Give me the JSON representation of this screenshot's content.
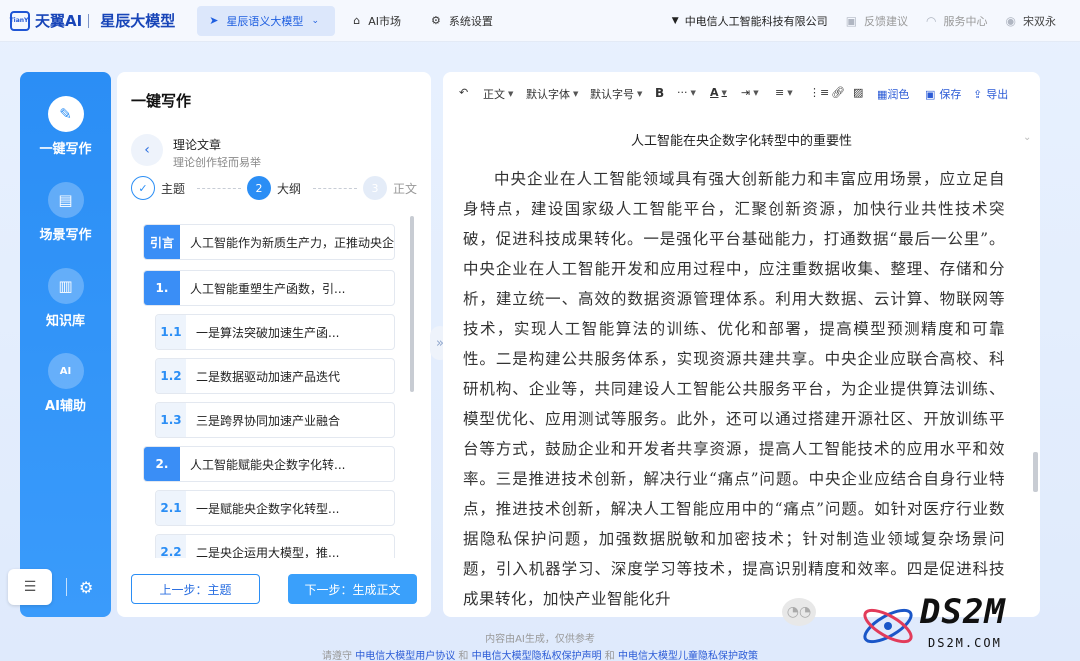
{
  "header": {
    "logo_badge": "TianYi",
    "brand": "天翼AI",
    "product": "星辰大模型",
    "nav": [
      {
        "label": "星辰语义大模型",
        "icon": "send-icon",
        "active": true
      },
      {
        "label": "AI市场",
        "icon": "store-icon",
        "active": false
      },
      {
        "label": "系统设置",
        "icon": "gear-icon",
        "active": false
      }
    ],
    "company": "中电信人工智能科技有限公司",
    "feedback": "反馈建议",
    "service": "服务中心",
    "user": "宋双永"
  },
  "sidebar": {
    "items": [
      {
        "label": "一键写作",
        "icon": "pen-icon",
        "active": true
      },
      {
        "label": "场景写作",
        "icon": "document-icon",
        "active": false
      },
      {
        "label": "知识库",
        "icon": "books-icon",
        "active": false
      },
      {
        "label": "AI辅助",
        "icon": "ai-icon",
        "active": false
      }
    ]
  },
  "outline_panel": {
    "title": "一键写作",
    "article_type": "理论文章",
    "article_subtitle": "理论创作轻而易举",
    "steps": [
      {
        "label": "主题",
        "state": "done",
        "num": "✓"
      },
      {
        "label": "大纲",
        "state": "current",
        "num": "2"
      },
      {
        "label": "正文",
        "state": "todo",
        "num": "3"
      }
    ],
    "items": [
      {
        "num": "引言",
        "text": "人工智能作为新质生产力，正推动央企",
        "level": "intro"
      },
      {
        "num": "1.",
        "text": "人工智能重塑生产函数，引...",
        "level": "level1"
      },
      {
        "num": "1.1",
        "text": "一是算法突破加速生产函...",
        "level": "level2"
      },
      {
        "num": "1.2",
        "text": "二是数据驱动加速产品迭代",
        "level": "level2"
      },
      {
        "num": "1.3",
        "text": "三是跨界协同加速产业融合",
        "level": "level2"
      },
      {
        "num": "2.",
        "text": "人工智能赋能央企数字化转...",
        "level": "level1"
      },
      {
        "num": "2.1",
        "text": "一是赋能央企数字化转型...",
        "level": "level2"
      },
      {
        "num": "2.2",
        "text": "二是央企运用大模型，推...",
        "level": "level2"
      }
    ],
    "prev_button": "上一步：主题",
    "next_button": "下一步：生成正文"
  },
  "editor": {
    "toolbar": {
      "paragraph": "正文",
      "font": "默认字体",
      "size": "默认字号",
      "bold": "B",
      "more": "···",
      "color": "A",
      "save": "保存",
      "export": "导出",
      "overlap": "润色"
    },
    "doc_title": "人工智能在央企数字化转型中的重要性",
    "doc_body": "中央企业在人工智能领域具有强大创新能力和丰富应用场景，应立足自身特点，建设国家级人工智能平台，汇聚创新资源，加快行业共性技术突破，促进科技成果转化。一是强化平台基础能力，打通数据“最后一公里”。中央企业在人工智能开发和应用过程中，应注重数据收集、整理、存储和分析，建立统一、高效的数据资源管理体系。利用大数据、云计算、物联网等技术，实现人工智能算法的训练、优化和部署，提高模型预测精度和可靠性。二是构建公共服务体系，实现资源共建共享。中央企业应联合高校、科研机构、企业等，共同建设人工智能公共服务平台，为企业提供算法训练、模型优化、应用测试等服务。此外，还可以通过搭建开源社区、开放训练平台等方式，鼓励企业和开发者共享资源，提高人工智能技术的应用水平和效率。三是推进技术创新，解决行业“痛点”问题。中央企业应结合自身行业特点，推进技术创新，解决人工智能应用中的“痛点”问题。如针对医疗行业数据隐私保护问题，加强数据脱敏和加密技术；针对制造业领域复杂场景问题，引入机器学习、深度学习等技术，提高识别精度和效率。四是促进科技成果转化，加快产业智能化升"
  },
  "footer": {
    "note": "内容由AI生成，仅供参考",
    "prefix": "请遵守",
    "link1": "中电信大模型用户协议",
    "and1": "和",
    "link2": "中电信大模型隐私权保护声明",
    "and2": "和",
    "link3": "中电信大模型儿童隐私保护政策"
  },
  "watermark": {
    "logo": "DS2M",
    "site": "DS2M.COM"
  }
}
